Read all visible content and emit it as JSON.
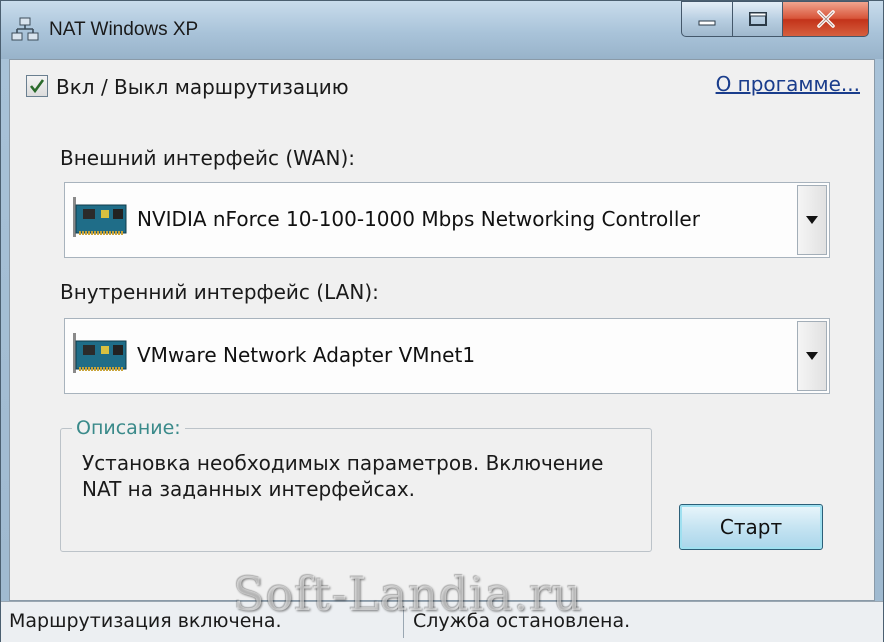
{
  "window": {
    "title": "NAT Windows XP",
    "icon": "network-icon"
  },
  "routing_toggle": {
    "label": "Вкл / Выкл маршрутизацию",
    "checked": true
  },
  "about_link": "О прогамме...",
  "wan": {
    "label": "Внешний интерфейс (WAN):",
    "selected": "NVIDIA nForce 10-100-1000 Mbps Networking Controller",
    "icon": "network-card-icon"
  },
  "lan": {
    "label": "Внутренний интерфейс (LAN):",
    "selected": "VMware Network Adapter VMnet1",
    "icon": "network-card-icon"
  },
  "description": {
    "legend": "Описание:",
    "text_line1": "Установка необходимых параметров. Включение",
    "text_line2": "NAT на заданных интерфейсах."
  },
  "start_button": "Старт",
  "status": {
    "left": "Маршрутизация включена.",
    "right": "Служба остановлена."
  },
  "watermark": "Soft-Landia.ru",
  "colors": {
    "close_button": "#d8553a",
    "link": "#1a3d8c",
    "legend": "#3a8a8a"
  }
}
